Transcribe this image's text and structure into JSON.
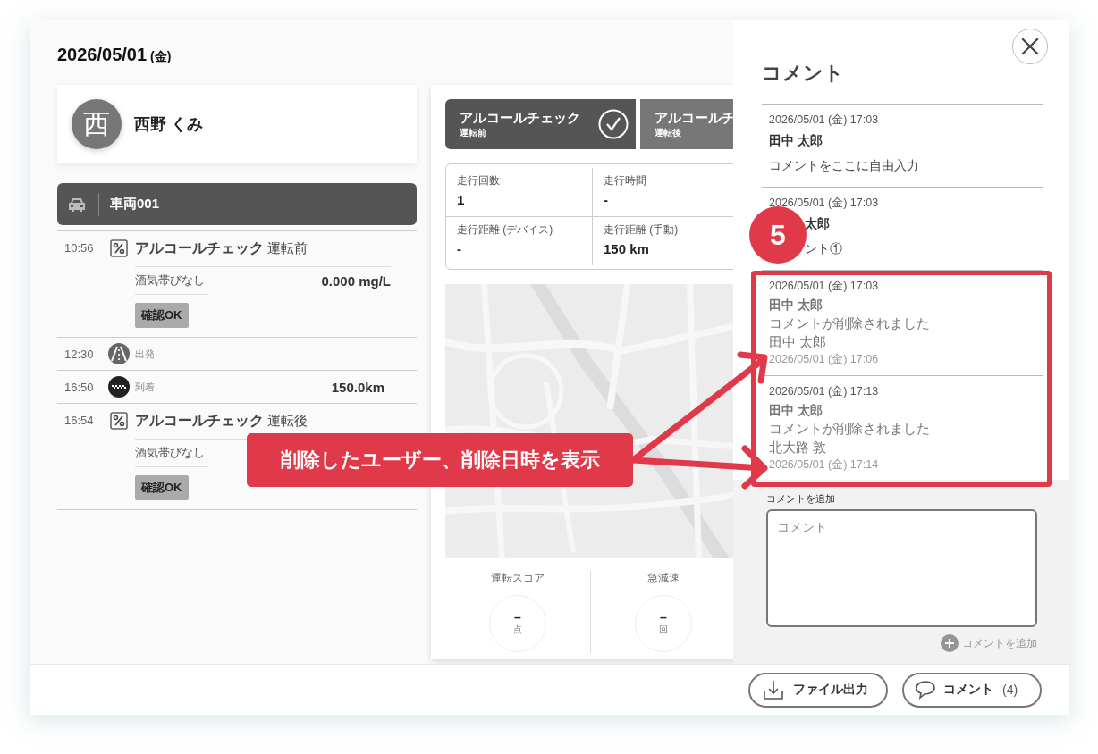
{
  "date": "2026/05/01",
  "weekday": "(金)",
  "driver": {
    "initial": "西",
    "name": "西野 くみ"
  },
  "vehicle": "車両001",
  "timeline": [
    {
      "kind": "check",
      "time": "10:56",
      "title": "アルコールチェック",
      "phase": "運転前",
      "result": "酒気帯びなし",
      "value": "0.000 mg/L",
      "badge": "確認OK"
    },
    {
      "kind": "depart",
      "time": "12:30",
      "label": "出発"
    },
    {
      "kind": "arrive",
      "time": "16:50",
      "label": "到着",
      "distance": "150.0km"
    },
    {
      "kind": "check",
      "time": "16:54",
      "title": "アルコールチェック",
      "phase": "運転後",
      "result": "酒気帯びなし",
      "badge": "確認OK"
    }
  ],
  "check_tabs": [
    {
      "title": "アルコールチェック",
      "phase": "運転前",
      "selected": true
    },
    {
      "title": "アルコールチ",
      "phase": "運転後",
      "selected": false
    }
  ],
  "stats": [
    {
      "label": "走行回数",
      "value": "1"
    },
    {
      "label": "走行時間",
      "value": "-"
    },
    {
      "label": "走行距離 (デバイス)",
      "value": "-"
    },
    {
      "label": "走行距離 (手動)",
      "value": "150 km"
    }
  ],
  "scores": [
    {
      "label": "運転スコア",
      "value": "–",
      "unit": "点"
    },
    {
      "label": "急減速",
      "value": "–",
      "unit": "回"
    }
  ],
  "comments_panel": {
    "title": "コメント",
    "comments": [
      {
        "kind": "normal",
        "date": "2026/05/01 (金) 17:03",
        "author": "田中 太郎",
        "body": "コメントをここに自由入力"
      },
      {
        "kind": "covered",
        "date": "2026/05/01 (金) 17:03",
        "author": "太郎",
        "body": "ント①"
      },
      {
        "kind": "deleted",
        "date": "2026/05/01 (金) 17:03",
        "author": "田中 太郎",
        "body": "コメントが削除されました",
        "deleted_by": "田中 太郎",
        "deleted_at": "2026/05/01 (金) 17:06"
      },
      {
        "kind": "deleted",
        "date": "2026/05/01 (金) 17:13",
        "author": "田中 太郎",
        "body": "コメントが削除されました",
        "deleted_by": "北大路 敦",
        "deleted_at": "2026/05/01 (金) 17:14"
      }
    ],
    "add_label": "コメントを追加",
    "placeholder": "コメント",
    "add_button": {
      "label": "コメントを追加",
      "disabled": true
    }
  },
  "footer": {
    "export_button": "ファイル出力",
    "comment_button": "コメント",
    "comment_count": "(4)"
  },
  "annotation": {
    "badge": "5",
    "callout": "削除したユーザー、削除日時を表示"
  }
}
